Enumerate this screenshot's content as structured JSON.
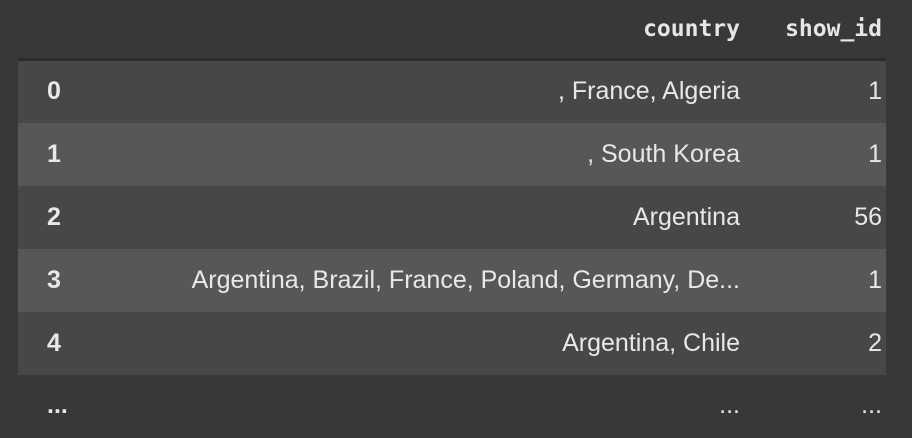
{
  "table": {
    "columns": {
      "index": "",
      "country": "country",
      "show_id": "show_id"
    },
    "rows": [
      {
        "index": "0",
        "country": ", France, Algeria",
        "show_id": "1"
      },
      {
        "index": "1",
        "country": ", South Korea",
        "show_id": "1"
      },
      {
        "index": "2",
        "country": "Argentina",
        "show_id": "56"
      },
      {
        "index": "3",
        "country": "Argentina, Brazil, France, Poland, Germany, De...",
        "show_id": "1"
      },
      {
        "index": "4",
        "country": "Argentina, Chile",
        "show_id": "2"
      }
    ],
    "ellipsis": {
      "index": "...",
      "country": "...",
      "show_id": "..."
    }
  },
  "colors": {
    "background": "#383838",
    "row_odd": "#474747",
    "row_even": "#575757",
    "text": "#e8e8e8"
  }
}
